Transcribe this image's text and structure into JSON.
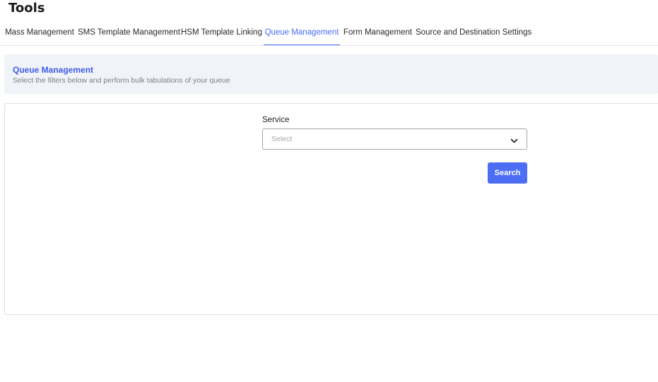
{
  "page": {
    "title": "Tools"
  },
  "tabs": [
    {
      "label": "Mass Management",
      "active": false
    },
    {
      "label": "SMS Template Management",
      "active": false
    },
    {
      "label": "HSM Template Linking",
      "active": false
    },
    {
      "label": "Queue Management",
      "active": true
    },
    {
      "label": "Form Management",
      "active": false
    },
    {
      "label": "Source and Destination Settings",
      "active": false
    }
  ],
  "banner": {
    "title": "Queue Management",
    "subtitle": "Select the filters below and perform bulk tabulations of your queue"
  },
  "filters": {
    "service": {
      "label": "Service",
      "placeholder": "Select",
      "icon": "chevron-down-icon"
    },
    "search_label": "Search"
  },
  "colors": {
    "accent": "#4c6ef5",
    "banner_bg": "#f0f3f8",
    "banner_title": "#3d5ce6"
  }
}
